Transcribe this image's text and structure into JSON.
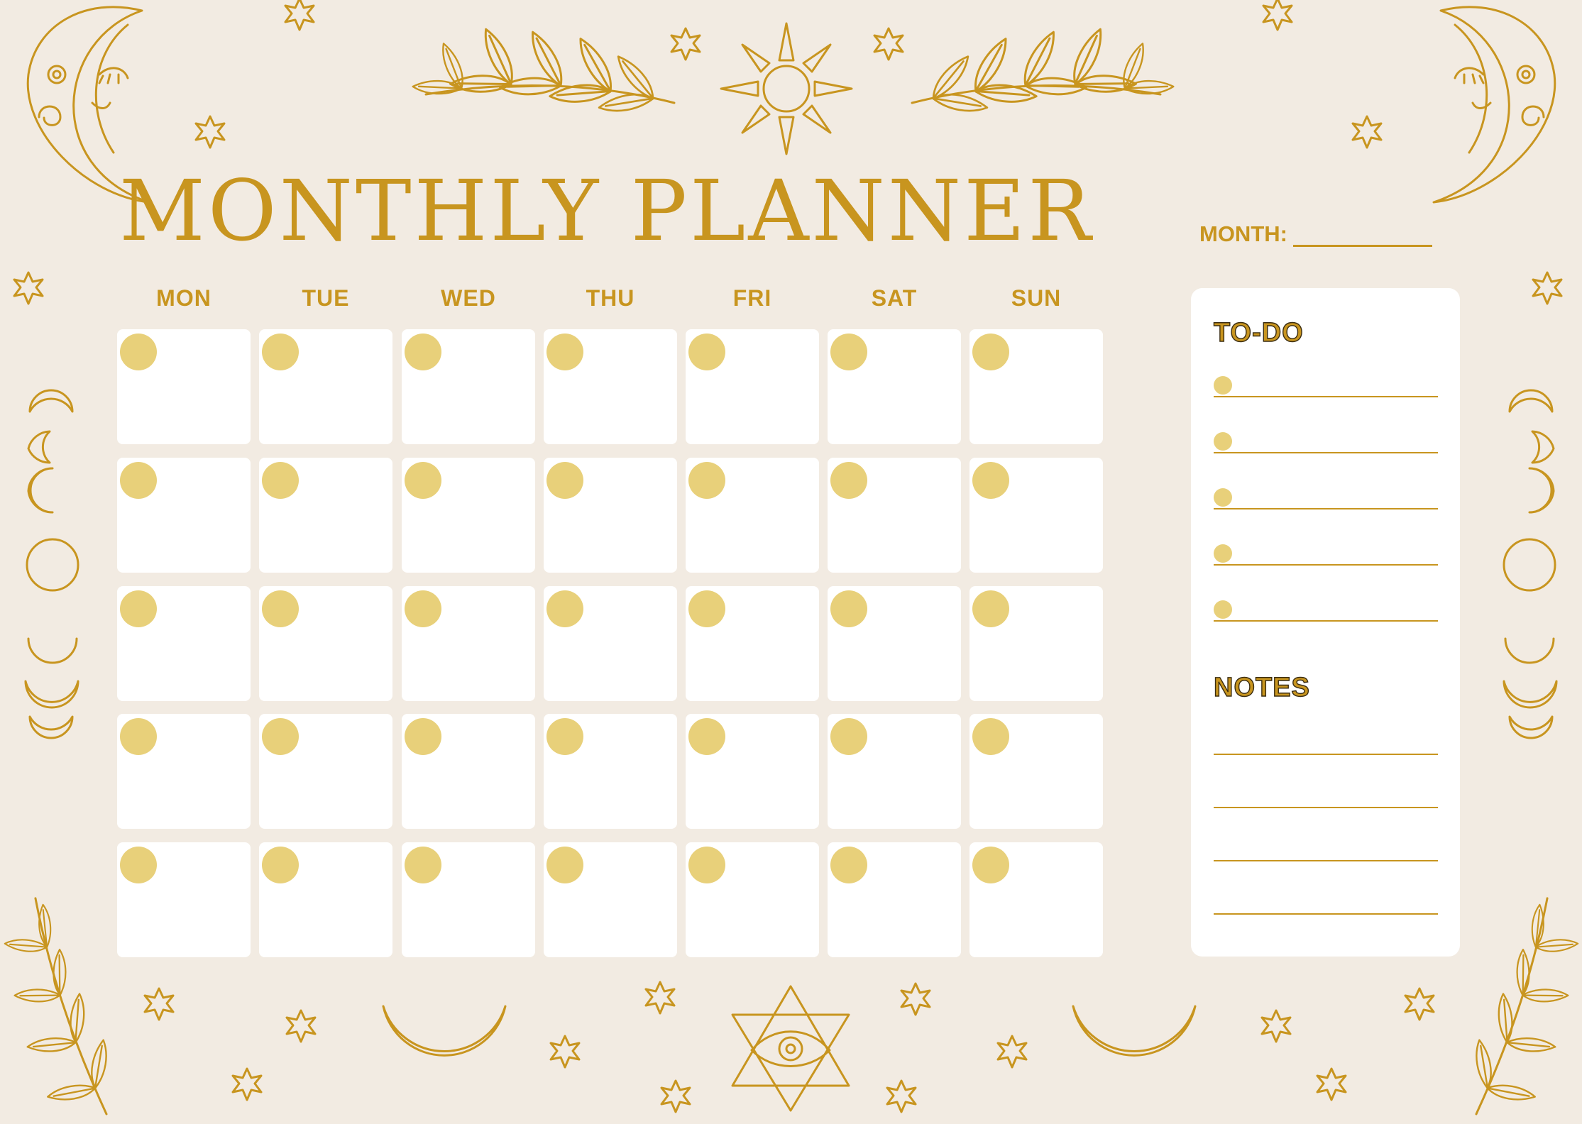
{
  "title": "MONTHLY PLANNER",
  "month_label": "MONTH:",
  "days": [
    "MON",
    "TUE",
    "WED",
    "THU",
    "FRI",
    "SAT",
    "SUN"
  ],
  "weeks": 5,
  "todo": {
    "heading": "TO-DO",
    "item_count": 5
  },
  "notes": {
    "heading": "NOTES",
    "line_count": 4
  },
  "colors": {
    "background": "#f2ebe2",
    "accent_gold": "#c8951f",
    "dot_yellow": "#e8d07a",
    "cell_white": "#ffffff"
  },
  "decorations": [
    "crescent-moon-face-icon",
    "sun-icon",
    "laurel-branch-icon",
    "star-icon",
    "moon-phases-icon",
    "eye-triangle-icon",
    "crescent-moon-icon"
  ]
}
